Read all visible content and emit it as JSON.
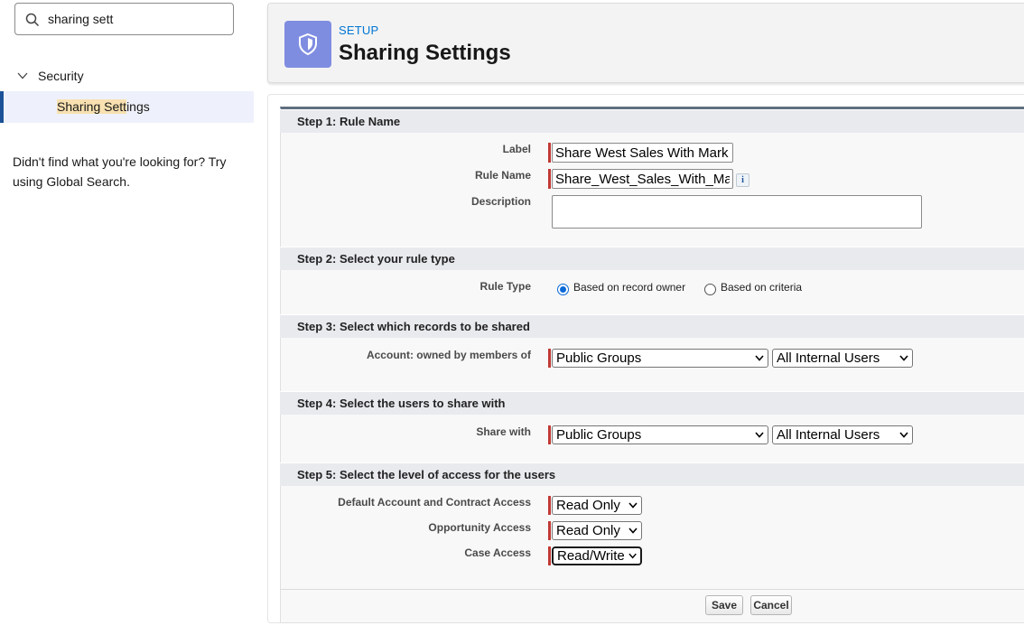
{
  "sidebar": {
    "search_value": "sharing sett",
    "tree_parent": "Security",
    "tree_child_highlight": "Sharing Sett",
    "tree_child_rest": "ings",
    "not_found_text": "Didn't find what you're looking for? Try using Global Search."
  },
  "header": {
    "breadcrumb": "SETUP",
    "title": "Sharing Settings"
  },
  "steps": {
    "step1": "Step 1: Rule Name",
    "step2": "Step 2: Select your rule type",
    "step3": "Step 3: Select which records to be shared",
    "step4": "Step 4: Select the users to share with",
    "step5": "Step 5: Select the level of access for the users"
  },
  "fields": {
    "label_label": "Label",
    "label_value": "Share West Sales With Mark",
    "rule_name_label": "Rule Name",
    "rule_name_value": "Share_West_Sales_With_Ma",
    "info_icon_text": "i",
    "description_label": "Description",
    "description_value": "",
    "rule_type_label": "Rule Type",
    "rule_type_option1": "Based on record owner",
    "rule_type_option2": "Based on criteria",
    "rule_type_selected": "Based on record owner",
    "owned_by_label": "Account: owned by members of",
    "owned_by_type": "Public Groups",
    "owned_by_group": "All Internal Users",
    "share_with_label": "Share with",
    "share_with_type": "Public Groups",
    "share_with_group": "All Internal Users",
    "account_access_label": "Default Account and Contract Access",
    "account_access_value": "Read Only",
    "opportunity_access_label": "Opportunity Access",
    "opportunity_access_value": "Read Only",
    "case_access_label": "Case Access",
    "case_access_value": "Read/Write"
  },
  "buttons": {
    "save": "Save",
    "cancel": "Cancel"
  },
  "colors": {
    "header_icon_bg": "#7f8de1",
    "required_bar": "#c23934",
    "link_blue": "#0176d3",
    "selected_tree_bg": "#eef1fb"
  }
}
